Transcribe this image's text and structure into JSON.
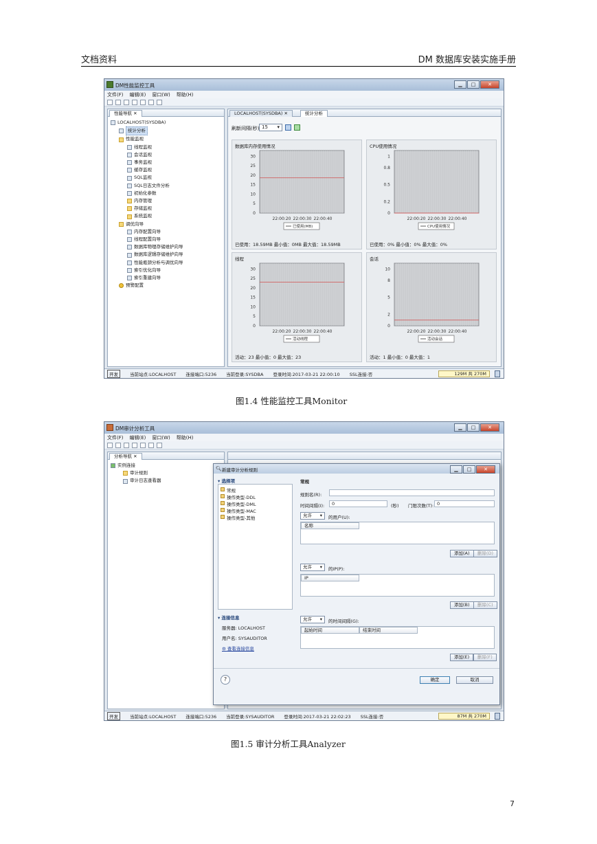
{
  "header": {
    "left": "文档资料",
    "right": "DM 数据库安装实施手册"
  },
  "figure1": {
    "caption": "图1.4 性能监控工具Monitor",
    "window_title": "DM性能监控工具",
    "menu": [
      "文件(F)",
      "编辑(E)",
      "窗口(W)",
      "帮助(H)"
    ],
    "nav_tab": "性能导航",
    "tree": [
      {
        "label": "LOCALHOST(SYSDBA)",
        "level": 0,
        "icon": "server"
      },
      {
        "label": "统计分析",
        "level": 1,
        "icon": "chart",
        "selected": true
      },
      {
        "label": "性能监视",
        "level": 1,
        "icon": "folder"
      },
      {
        "label": "线程监视",
        "level": 2,
        "icon": "item"
      },
      {
        "label": "会话监视",
        "level": 2,
        "icon": "item"
      },
      {
        "label": "事务监视",
        "level": 2,
        "icon": "item"
      },
      {
        "label": "缓存监视",
        "level": 2,
        "icon": "item"
      },
      {
        "label": "SQL监视",
        "level": 2,
        "icon": "item"
      },
      {
        "label": "SQL日志文件分析",
        "level": 2,
        "icon": "item"
      },
      {
        "label": "初始化参数",
        "level": 2,
        "icon": "item"
      },
      {
        "label": "内存管理",
        "level": 2,
        "icon": "folder"
      },
      {
        "label": "存储监视",
        "level": 2,
        "icon": "folder"
      },
      {
        "label": "系统监视",
        "level": 2,
        "icon": "folder"
      },
      {
        "label": "调优向导",
        "level": 1,
        "icon": "folder"
      },
      {
        "label": "内存配置向导",
        "level": 2,
        "icon": "item"
      },
      {
        "label": "线程配置向导",
        "level": 2,
        "icon": "item"
      },
      {
        "label": "数据库物理存储维护向导",
        "level": 2,
        "icon": "item"
      },
      {
        "label": "数据库逻辑存储维护向导",
        "level": 2,
        "icon": "item"
      },
      {
        "label": "性能瓶颈分析与调优向导",
        "level": 2,
        "icon": "item"
      },
      {
        "label": "索引优化向导",
        "level": 2,
        "icon": "item"
      },
      {
        "label": "索引重建向导",
        "level": 2,
        "icon": "item"
      },
      {
        "label": "预警配置",
        "level": 1,
        "icon": "gear"
      }
    ],
    "tab_main": "LOCALHOST(SYSDBA)",
    "tab_stats": "统计分析",
    "refresh_label": "刷新间隔(秒)",
    "refresh_value": "15",
    "status": {
      "open_box": "开发",
      "site": "当前站点:LOCALHOST",
      "port": "连接端口:5236",
      "login": "当前登录:SYSDBA",
      "login_time": "登录时间:2017-03-21 22:00:10",
      "ssl": "SSL连接:否",
      "memory": "129M 共 270M"
    }
  },
  "chart_data": [
    {
      "type": "line",
      "title": "数据库内存使用情况",
      "x": [
        "22:00:20",
        "22:00:30",
        "22:00:40"
      ],
      "yticks": [
        0,
        5,
        10,
        15,
        20,
        25,
        30
      ],
      "ylim": [
        0,
        33
      ],
      "series": [
        {
          "name": "已使用(MB)",
          "values": [
            18.59,
            18.59,
            18.59
          ],
          "color": "#d06060"
        }
      ],
      "stats": "已使用：18.59MB   最小值：0MB   最大值：18.59MB"
    },
    {
      "type": "line",
      "title": "CPU使用情况",
      "x": [
        "22:00:20",
        "22:00:30",
        "22:00:40"
      ],
      "yticks": [
        0,
        0.2,
        0.5,
        0.8,
        1
      ],
      "ylim": [
        0,
        1.1
      ],
      "series": [
        {
          "name": "CPU使用情况",
          "values": [
            0,
            0,
            0
          ],
          "color": "#d06060"
        }
      ],
      "stats": "已使用：0%   最小值：0%   最大值：0%"
    },
    {
      "type": "line",
      "title": "线程",
      "x": [
        "22:00:20",
        "22:00:30",
        "22:00:40"
      ],
      "yticks": [
        0,
        5,
        10,
        15,
        20,
        25,
        30
      ],
      "ylim": [
        0,
        33
      ],
      "series": [
        {
          "name": "活动线程",
          "values": [
            23,
            23,
            23
          ],
          "color": "#d06060"
        }
      ],
      "stats": "活动：23   最小值：0   最大值：23"
    },
    {
      "type": "line",
      "title": "会话",
      "x": [
        "22:00:20",
        "22:00:30",
        "22:00:40"
      ],
      "yticks": [
        0,
        2,
        5,
        8,
        10
      ],
      "ylim": [
        0,
        11
      ],
      "series": [
        {
          "name": "活动会话",
          "values": [
            1,
            1,
            1
          ],
          "color": "#d06060"
        }
      ],
      "stats": "活动：1   最小值：0   最大值：1"
    }
  ],
  "figure2": {
    "caption": "图1.5 审计分析工具Analyzer",
    "window_title": "DM审计分析工具",
    "menu": [
      "文件(F)",
      "编辑(E)",
      "窗口(W)",
      "帮助(H)"
    ],
    "nav_tab": "分析导航",
    "tree": [
      {
        "label": "实例连接",
        "level": 0
      },
      {
        "label": "审计规则",
        "level": 1
      },
      {
        "label": "审计日志查看器",
        "level": 1
      }
    ],
    "dialog": {
      "title": "新建审计分析规则",
      "select_section": "选择项",
      "options": [
        "常规",
        "操作类型-DDL",
        "操作类型-DML",
        "操作类型-MAC",
        "操作类型-其他"
      ],
      "conn_section": "连接信息",
      "server": "服务器: LOCALHOST",
      "user": "用户名: SYSAUDITOR",
      "view_conn": "查看连接信息",
      "form_title": "常规",
      "rule_name_label": "规则名(R):",
      "interval_label": "时间间隔(I):",
      "interval_value": "0",
      "sec_unit": "(秒)",
      "threshold_label": "门限次数(T):",
      "threshold_value": "0",
      "allow": "允许",
      "user_label": "的用户(U):",
      "name_col": "名称",
      "add_a": "添加(A)",
      "del_d": "删除(D)",
      "ip_label": "的IP(P):",
      "ip_col": "IP",
      "add_b": "添加(B)",
      "del_c": "删除(C)",
      "time_label": "的时间间隔(G):",
      "start_col": "起始时间",
      "end_col": "结束时间",
      "add_e": "添加(E)",
      "del_f": "删除(F)",
      "ok": "确定",
      "cancel": "取消"
    },
    "status": {
      "open_box": "开发",
      "site": "当前站点:LOCALHOST",
      "port": "连接端口:5236",
      "login": "当前登录:SYSAUDITOR",
      "login_time": "登录时间:2017-03-21 22:02:23",
      "ssl": "SSL连接:否",
      "memory": "87M 共 270M"
    }
  },
  "page_number": "7"
}
